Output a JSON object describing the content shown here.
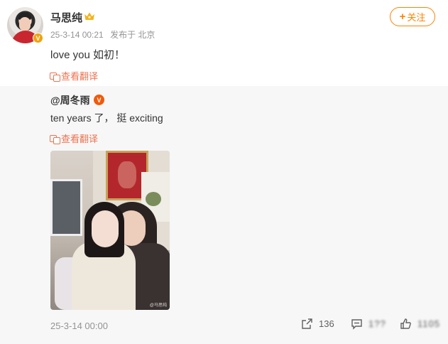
{
  "post": {
    "author": "马思纯",
    "timestamp": "25-3-14 00:21",
    "source": "发布于 北京",
    "text": "love you 如初！",
    "follow_label": "关注",
    "translate_label": "查看翻译"
  },
  "repost": {
    "author": "@周冬雨",
    "text": "ten years 了， 挺 exciting",
    "translate_label": "查看翻译",
    "image_watermark": "@马思纯",
    "timestamp": "25-3-14 00:00",
    "share_count": "136",
    "comment_count": "1??",
    "like_count": "1105"
  },
  "colors": {
    "accent": "#ff8200",
    "translate": "#eb7350",
    "verified_orange": "#f0a20c",
    "verified_red": "#f05a0b",
    "muted": "#939393",
    "repost_bg": "#f7f7f7"
  },
  "icons": {
    "verified": "verified-badge-icon",
    "vip": "crown-icon",
    "translate": "translate-icon",
    "share": "share-icon",
    "comment": "comment-icon",
    "like": "thumbs-up-icon"
  }
}
